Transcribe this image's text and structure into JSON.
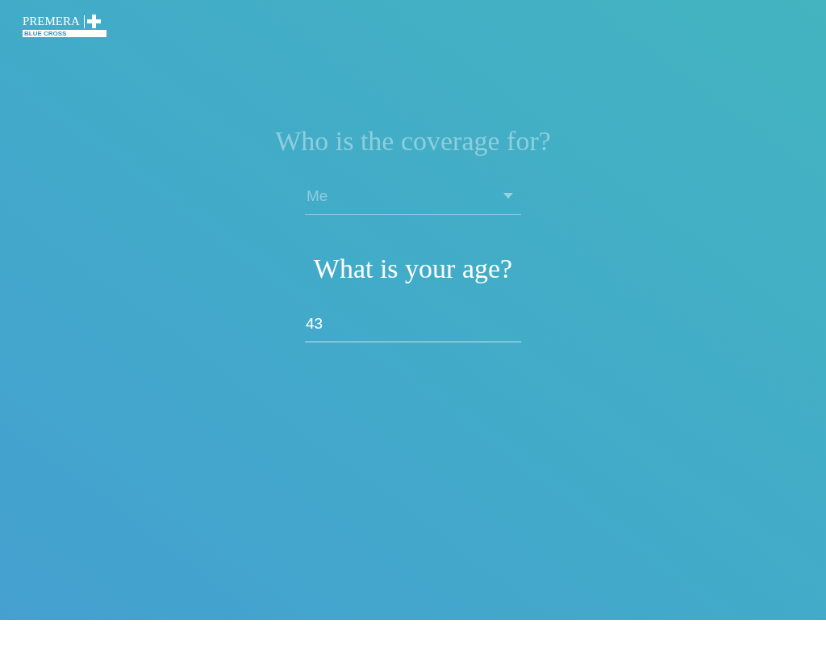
{
  "logo": {
    "name": "PREMERA",
    "tagline": "BLUE CROSS"
  },
  "questions": [
    {
      "kind": "select",
      "prompt": "Who is the coverage for?",
      "value": "Me",
      "active": false
    },
    {
      "kind": "text",
      "prompt": "What is your age?",
      "value": "43",
      "active": true
    }
  ]
}
